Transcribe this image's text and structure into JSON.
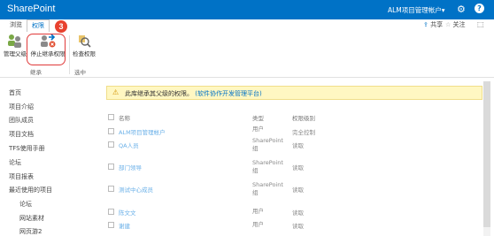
{
  "suite_bar": {
    "brand": "SharePoint",
    "user": "ALM项目管理帐户▾",
    "help": "?"
  },
  "tabs": [
    {
      "label": "浏览"
    },
    {
      "label": "权限"
    }
  ],
  "actions": {
    "share": "共享",
    "follow": "关注"
  },
  "ribbon": {
    "buttons": [
      {
        "label": "管理父级"
      },
      {
        "label": "停止继承权限"
      },
      {
        "label": "检查权限"
      }
    ],
    "groups": [
      {
        "label": "继承"
      },
      {
        "label": "选中"
      }
    ],
    "step_badge": "3"
  },
  "nav": {
    "items": [
      {
        "label": "首页"
      },
      {
        "label": "项目介绍"
      },
      {
        "label": "团队成员"
      },
      {
        "label": "项目文档"
      },
      {
        "label": "TFS使用手册"
      },
      {
        "label": "论坛"
      },
      {
        "label": "项目报表"
      },
      {
        "label": "最近使用的项目"
      },
      {
        "label": "论坛"
      },
      {
        "label": "网站素材"
      },
      {
        "label": "网页游2"
      }
    ]
  },
  "notice": {
    "text": "此库继承其父级的权限。",
    "link": "(软件协作开发管理平台)"
  },
  "table": {
    "headers": [
      "名称",
      "类型",
      "权限级别"
    ],
    "rows": [
      {
        "name": "ALM项目管理帐户",
        "type": "用户",
        "perm": "完全控制"
      },
      {
        "name": "QA人员",
        "type": "SharePoint 组",
        "perm": "读取"
      },
      {
        "name": "部门领导",
        "type": "SharePoint 组",
        "perm": "读取"
      },
      {
        "name": "测试中心成员",
        "type": "SharePoint 组",
        "perm": "读取"
      },
      {
        "name": "陈文文",
        "type": "用户",
        "perm": "读取"
      },
      {
        "name": "谢建",
        "type": "用户",
        "perm": "读取"
      }
    ]
  },
  "colors": {
    "suite_blue": "#0072c6",
    "notice_bg": "#fff7c2",
    "highlight_red": "#e03a3a"
  }
}
